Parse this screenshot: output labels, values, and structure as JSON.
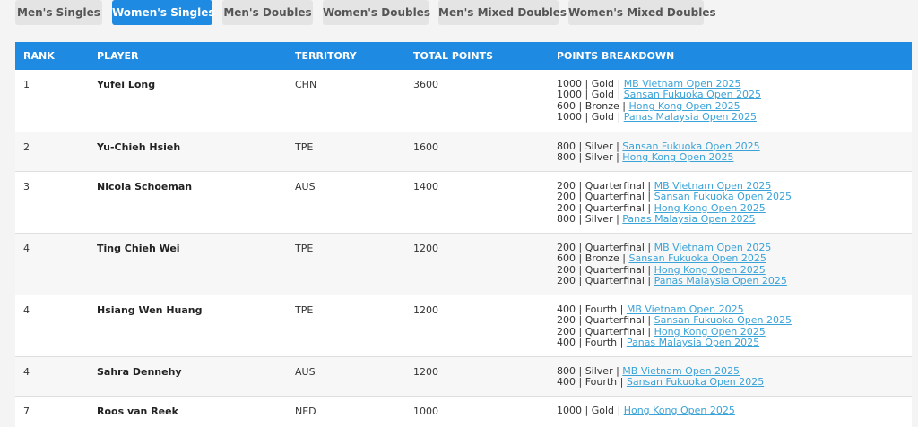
{
  "tabs": [
    {
      "label": "Men's Singles",
      "active": false
    },
    {
      "label": "Women's Singles",
      "active": true
    },
    {
      "label": "Men's Doubles",
      "active": false
    },
    {
      "label": "Women's Doubles",
      "active": false
    },
    {
      "label": "Men's Mixed Doubles",
      "active": false
    },
    {
      "label": "Women's Mixed Doubles",
      "active": false
    }
  ],
  "table": {
    "headers": {
      "rank": "RANK",
      "player": "PLAYER",
      "territory": "TERRITORY",
      "total_points": "TOTAL POINTS",
      "breakdown": "POINTS BREAKDOWN"
    },
    "rows": [
      {
        "rank": "1",
        "player": "Yufei Long",
        "territory": "CHN",
        "points": "3600",
        "breakdown": [
          {
            "text": "1000 | Gold | ",
            "link": "MB Vietnam Open 2025"
          },
          {
            "text": "1000 | Gold | ",
            "link": "Sansan Fukuoka Open 2025"
          },
          {
            "text": "600 | Bronze | ",
            "link": "Hong Kong Open 2025"
          },
          {
            "text": "1000 | Gold | ",
            "link": "Panas Malaysia Open 2025"
          }
        ]
      },
      {
        "rank": "2",
        "player": "Yu-Chieh Hsieh",
        "territory": "TPE",
        "points": "1600",
        "breakdown": [
          {
            "text": "800 | Silver | ",
            "link": "Sansan Fukuoka Open 2025"
          },
          {
            "text": "800 | Silver | ",
            "link": "Hong Kong Open 2025"
          }
        ]
      },
      {
        "rank": "3",
        "player": "Nicola Schoeman",
        "territory": "AUS",
        "points": "1400",
        "breakdown": [
          {
            "text": "200 | Quarterfinal | ",
            "link": "MB Vietnam Open 2025"
          },
          {
            "text": "200 | Quarterfinal | ",
            "link": "Sansan Fukuoka Open 2025"
          },
          {
            "text": "200 | Quarterfinal | ",
            "link": "Hong Kong Open 2025"
          },
          {
            "text": "800 | Silver | ",
            "link": "Panas Malaysia Open 2025"
          }
        ]
      },
      {
        "rank": "4",
        "player": "Ting Chieh Wei",
        "territory": "TPE",
        "points": "1200",
        "breakdown": [
          {
            "text": "200 | Quarterfinal | ",
            "link": "MB Vietnam Open 2025"
          },
          {
            "text": "600 | Bronze | ",
            "link": "Sansan Fukuoka Open 2025"
          },
          {
            "text": "200 | Quarterfinal | ",
            "link": "Hong Kong Open 2025"
          },
          {
            "text": "200 | Quarterfinal | ",
            "link": "Panas Malaysia Open 2025"
          }
        ]
      },
      {
        "rank": "4",
        "player": "Hsiang Wen Huang",
        "territory": "TPE",
        "points": "1200",
        "breakdown": [
          {
            "text": "400 | Fourth | ",
            "link": "MB Vietnam Open 2025"
          },
          {
            "text": "200 | Quarterfinal | ",
            "link": "Sansan Fukuoka Open 2025"
          },
          {
            "text": "200 | Quarterfinal | ",
            "link": "Hong Kong Open 2025"
          },
          {
            "text": "400 | Fourth | ",
            "link": "Panas Malaysia Open 2025"
          }
        ]
      },
      {
        "rank": "4",
        "player": "Sahra Dennehy",
        "territory": "AUS",
        "points": "1200",
        "breakdown": [
          {
            "text": "800 | Silver | ",
            "link": "MB Vietnam Open 2025"
          },
          {
            "text": "400 | Fourth | ",
            "link": "Sansan Fukuoka Open 2025"
          }
        ]
      },
      {
        "rank": "7",
        "player": "Roos van Reek",
        "territory": "NED",
        "points": "1000",
        "breakdown": [
          {
            "text": "1000 | Gold | ",
            "link": "Hong Kong Open 2025"
          }
        ]
      }
    ]
  }
}
